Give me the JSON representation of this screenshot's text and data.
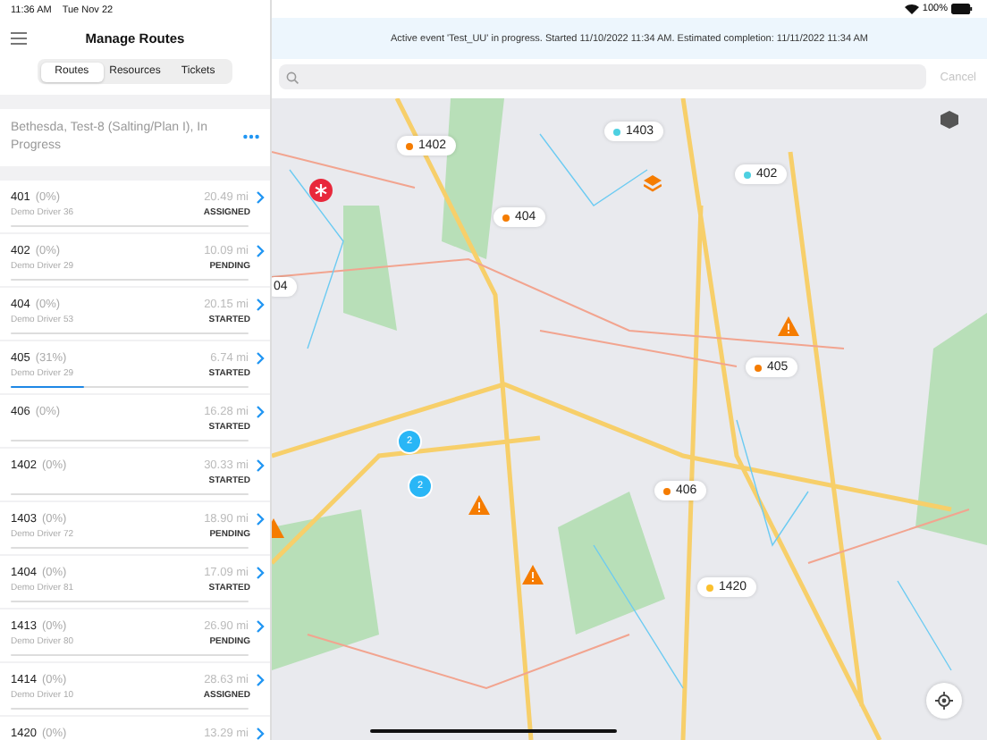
{
  "status_bar": {
    "time": "11:36 AM",
    "date": "Tue Nov 22",
    "battery": "100%"
  },
  "sidebar": {
    "title": "Manage Routes",
    "tabs": [
      {
        "label": "Routes",
        "selected": true
      },
      {
        "label": "Resources",
        "selected": false
      },
      {
        "label": "Tickets",
        "selected": false
      }
    ],
    "event": {
      "title": "Bethesda, Test-8 (Salting/Plan I), In Progress"
    },
    "routes": [
      {
        "name": "401",
        "percent": "(0%)",
        "distance": "20.49 mi",
        "driver": "Demo Driver 36",
        "status": "ASSIGNED",
        "level": 0
      },
      {
        "name": "402",
        "percent": "(0%)",
        "distance": "10.09 mi",
        "driver": "Demo Driver 29",
        "status": "PENDING",
        "level": 0
      },
      {
        "name": "404",
        "percent": "(0%)",
        "distance": "20.15 mi",
        "driver": "Demo Driver 53",
        "status": "STARTED",
        "level": 0
      },
      {
        "name": "405",
        "percent": "(31%)",
        "distance": "6.74 mi",
        "driver": "Demo Driver 29",
        "status": "STARTED",
        "level": 0.31
      },
      {
        "name": "406",
        "percent": "(0%)",
        "distance": "16.28 mi",
        "status": "STARTED",
        "level": 0
      },
      {
        "name": "1402",
        "percent": "(0%)",
        "distance": "30.33 mi",
        "status": "STARTED",
        "level": 0
      },
      {
        "name": "1403",
        "percent": "(0%)",
        "distance": "18.90 mi",
        "driver": "Demo Driver 72",
        "status": "PENDING",
        "level": 0
      },
      {
        "name": "1404",
        "percent": "(0%)",
        "distance": "17.09 mi",
        "driver": "Demo Driver 81",
        "status": "STARTED",
        "level": 0
      },
      {
        "name": "1413",
        "percent": "(0%)",
        "distance": "26.90 mi",
        "driver": "Demo Driver 80",
        "status": "PENDING",
        "level": 0
      },
      {
        "name": "1414",
        "percent": "(0%)",
        "distance": "28.63 mi",
        "driver": "Demo Driver 10",
        "status": "ASSIGNED",
        "level": 0
      },
      {
        "name": "1420",
        "percent": "(0%)",
        "distance": "13.29 mi"
      }
    ]
  },
  "banner": "Active event 'Test_UU' in progress. Started 11/10/2022 11:34 AM. Estimated completion: 11/11/2022 11:34 AM",
  "search": {
    "cancel": "Cancel"
  },
  "map": {
    "markers": [
      {
        "kind": "route",
        "label": "1402",
        "color": "#f57c00"
      },
      {
        "kind": "route",
        "label": "1403",
        "color": "#4dd0e1"
      },
      {
        "kind": "route",
        "label": "402",
        "color": "#4dd0e1"
      },
      {
        "kind": "route",
        "label": "404",
        "color": "#f57c00"
      },
      {
        "kind": "route",
        "label": "405",
        "color": "#f57c00"
      },
      {
        "kind": "route",
        "label": "406",
        "color": "#f57c00"
      },
      {
        "kind": "route",
        "label": "1420",
        "color": "#fbc02d"
      },
      {
        "kind": "route",
        "label": "04"
      },
      {
        "kind": "cluster",
        "label": "2"
      },
      {
        "kind": "cluster",
        "label": "2"
      }
    ]
  }
}
